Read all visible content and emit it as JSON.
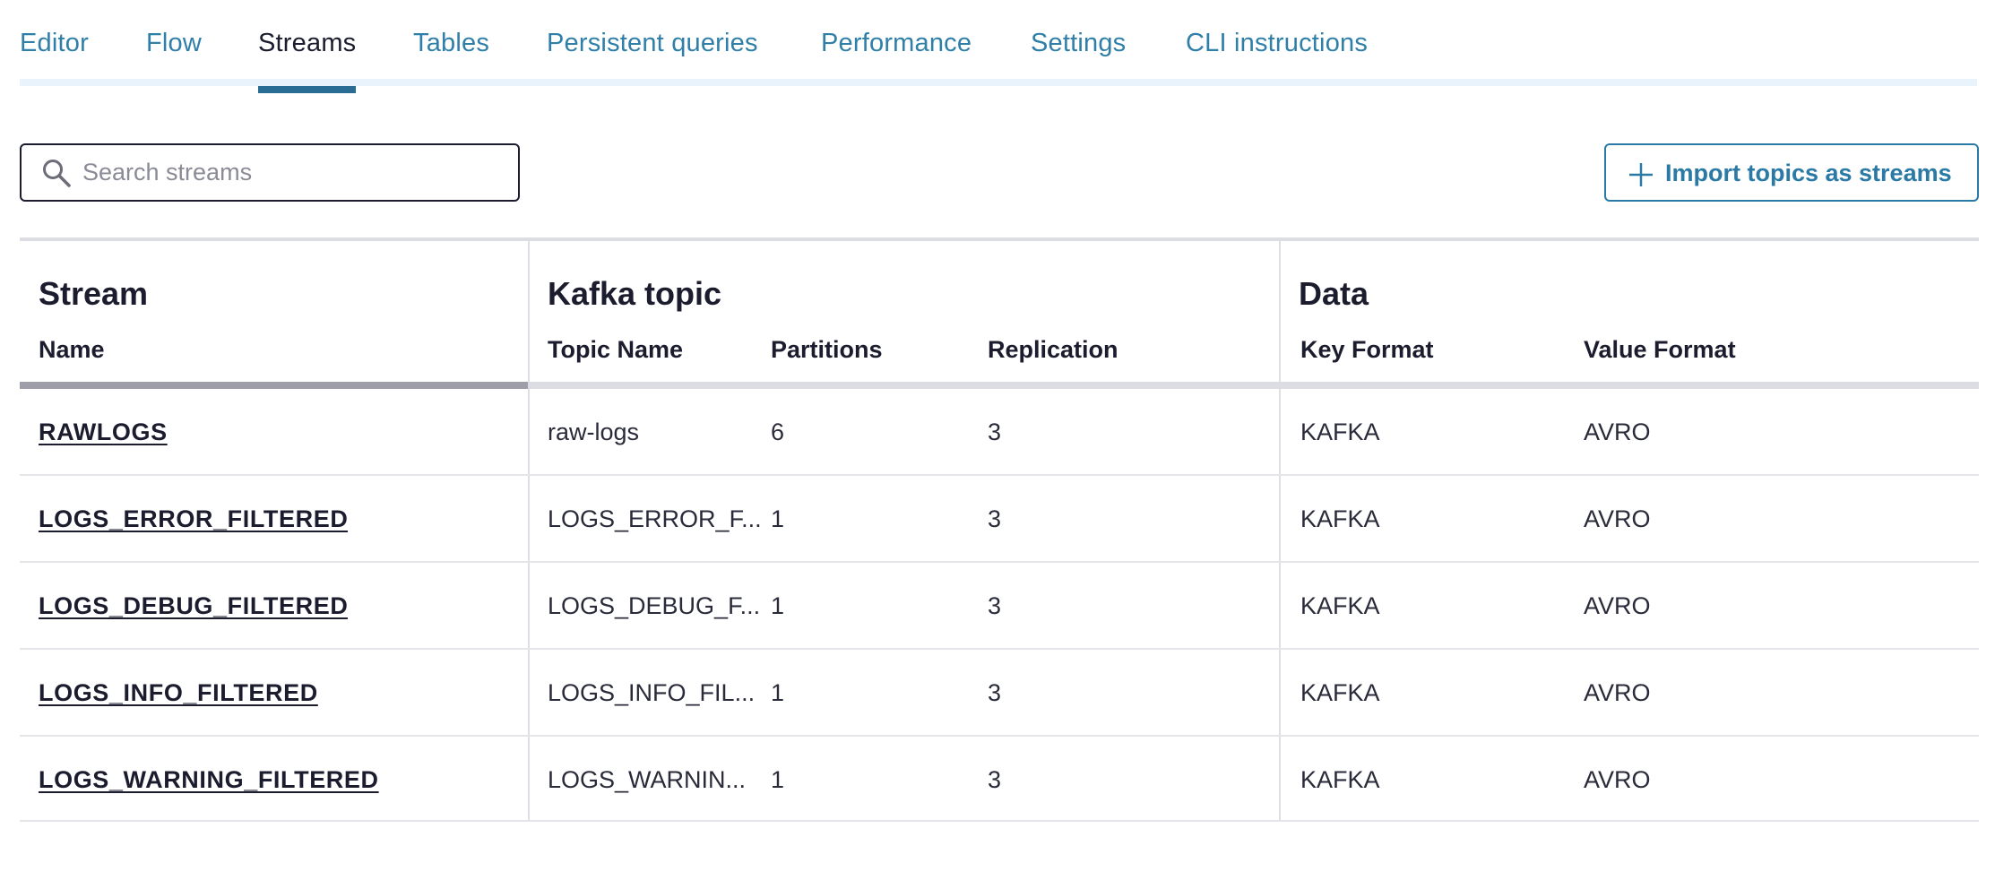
{
  "tabs": [
    {
      "label": "Editor",
      "active": false
    },
    {
      "label": "Flow",
      "active": false
    },
    {
      "label": "Streams",
      "active": true
    },
    {
      "label": "Tables",
      "active": false
    },
    {
      "label": "Persistent queries",
      "active": false
    },
    {
      "label": "Performance",
      "active": false
    },
    {
      "label": "Settings",
      "active": false
    },
    {
      "label": "CLI instructions",
      "active": false
    }
  ],
  "search": {
    "placeholder": "Search streams",
    "value": ""
  },
  "import_button": {
    "label": "Import topics as streams"
  },
  "table": {
    "groups": {
      "stream": "Stream",
      "kafka_topic": "Kafka topic",
      "data": "Data"
    },
    "columns": {
      "name": "Name",
      "topic_name": "Topic Name",
      "partitions": "Partitions",
      "replication": "Replication",
      "key_format": "Key Format",
      "value_format": "Value Format"
    },
    "rows": [
      {
        "name": "RAWLOGS",
        "topic": "raw-logs",
        "partitions": "6",
        "replication": "3",
        "key_format": "KAFKA",
        "value_format": "AVRO"
      },
      {
        "name": "LOGS_ERROR_FILTERED",
        "topic": "LOGS_ERROR_F...",
        "partitions": "1",
        "replication": "3",
        "key_format": "KAFKA",
        "value_format": "AVRO"
      },
      {
        "name": "LOGS_DEBUG_FILTERED",
        "topic": "LOGS_DEBUG_F...",
        "partitions": "1",
        "replication": "3",
        "key_format": "KAFKA",
        "value_format": "AVRO"
      },
      {
        "name": "LOGS_INFO_FILTERED",
        "topic": "LOGS_INFO_FIL...",
        "partitions": "1",
        "replication": "3",
        "key_format": "KAFKA",
        "value_format": "AVRO"
      },
      {
        "name": "LOGS_WARNING_FILTERED",
        "topic": "LOGS_WARNIN...",
        "partitions": "1",
        "replication": "3",
        "key_format": "KAFKA",
        "value_format": "AVRO"
      }
    ]
  },
  "colors": {
    "link": "#2f7fa8",
    "active_tab_underline": "#2a6d94",
    "tab_track": "#e8f3fb",
    "text": "#1b1c2e"
  }
}
